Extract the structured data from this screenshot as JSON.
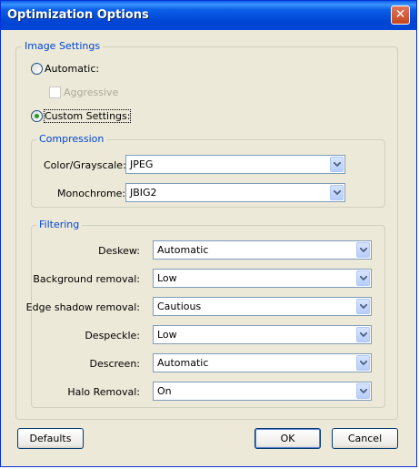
{
  "window": {
    "title": "Optimization Options"
  },
  "image_settings": {
    "legend": "Image Settings",
    "automatic_label": "Automatic:",
    "aggressive_label": "Aggressive",
    "custom_label": "Custom Settings:",
    "selected": "custom"
  },
  "compression": {
    "legend": "Compression",
    "color_label": "Color/Grayscale:",
    "color_value": "JPEG",
    "mono_label": "Monochrome:",
    "mono_value": "JBIG2"
  },
  "filtering": {
    "legend": "Filtering",
    "rows": [
      {
        "label": "Deskew:",
        "value": "Automatic"
      },
      {
        "label": "Background removal:",
        "value": "Low"
      },
      {
        "label": "Edge shadow removal:",
        "value": "Cautious"
      },
      {
        "label": "Despeckle:",
        "value": "Low"
      },
      {
        "label": "Descreen:",
        "value": "Automatic"
      },
      {
        "label": "Halo Removal:",
        "value": "On"
      }
    ]
  },
  "buttons": {
    "defaults": "Defaults",
    "ok": "OK",
    "cancel": "Cancel"
  }
}
